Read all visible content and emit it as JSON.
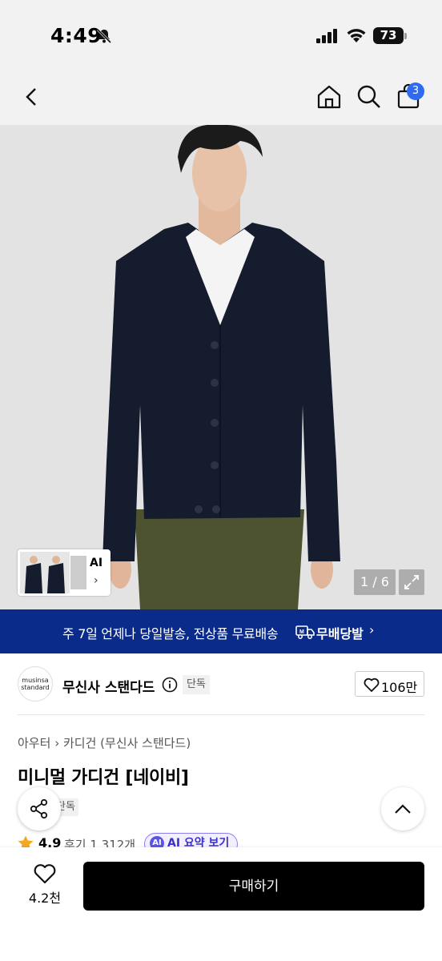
{
  "status_bar": {
    "time": "4:49",
    "battery": "73"
  },
  "header": {
    "cart_count": "3"
  },
  "gallery": {
    "ai_label": "AI",
    "counter": "1 / 6"
  },
  "banner": {
    "text": "주 7일 언제나 당일발송, 전상품 무료배송",
    "brand": "무배당발"
  },
  "brand": {
    "logo_text_1": "musinsa",
    "logo_text_2": "standard",
    "name": "무신사 스탠다드",
    "tag": "단독",
    "likes": "106만"
  },
  "product": {
    "breadcrumb_1": "아우터",
    "breadcrumb_2": "카디건 (무신사 스탠다드)",
    "name": "미니멀 가디건 [네이비]",
    "tag": "단독",
    "rating": "4.9",
    "reviews": "후기 1,312개",
    "ai_summary_badge": "AI",
    "ai_summary_label": "AI 요약 보기"
  },
  "bottom_bar": {
    "wish_count": "4.2천",
    "buy_label": "구매하기"
  },
  "colors": {
    "banner": "#0a2b8a",
    "badge": "#2f6bf0",
    "buy": "#000000"
  }
}
